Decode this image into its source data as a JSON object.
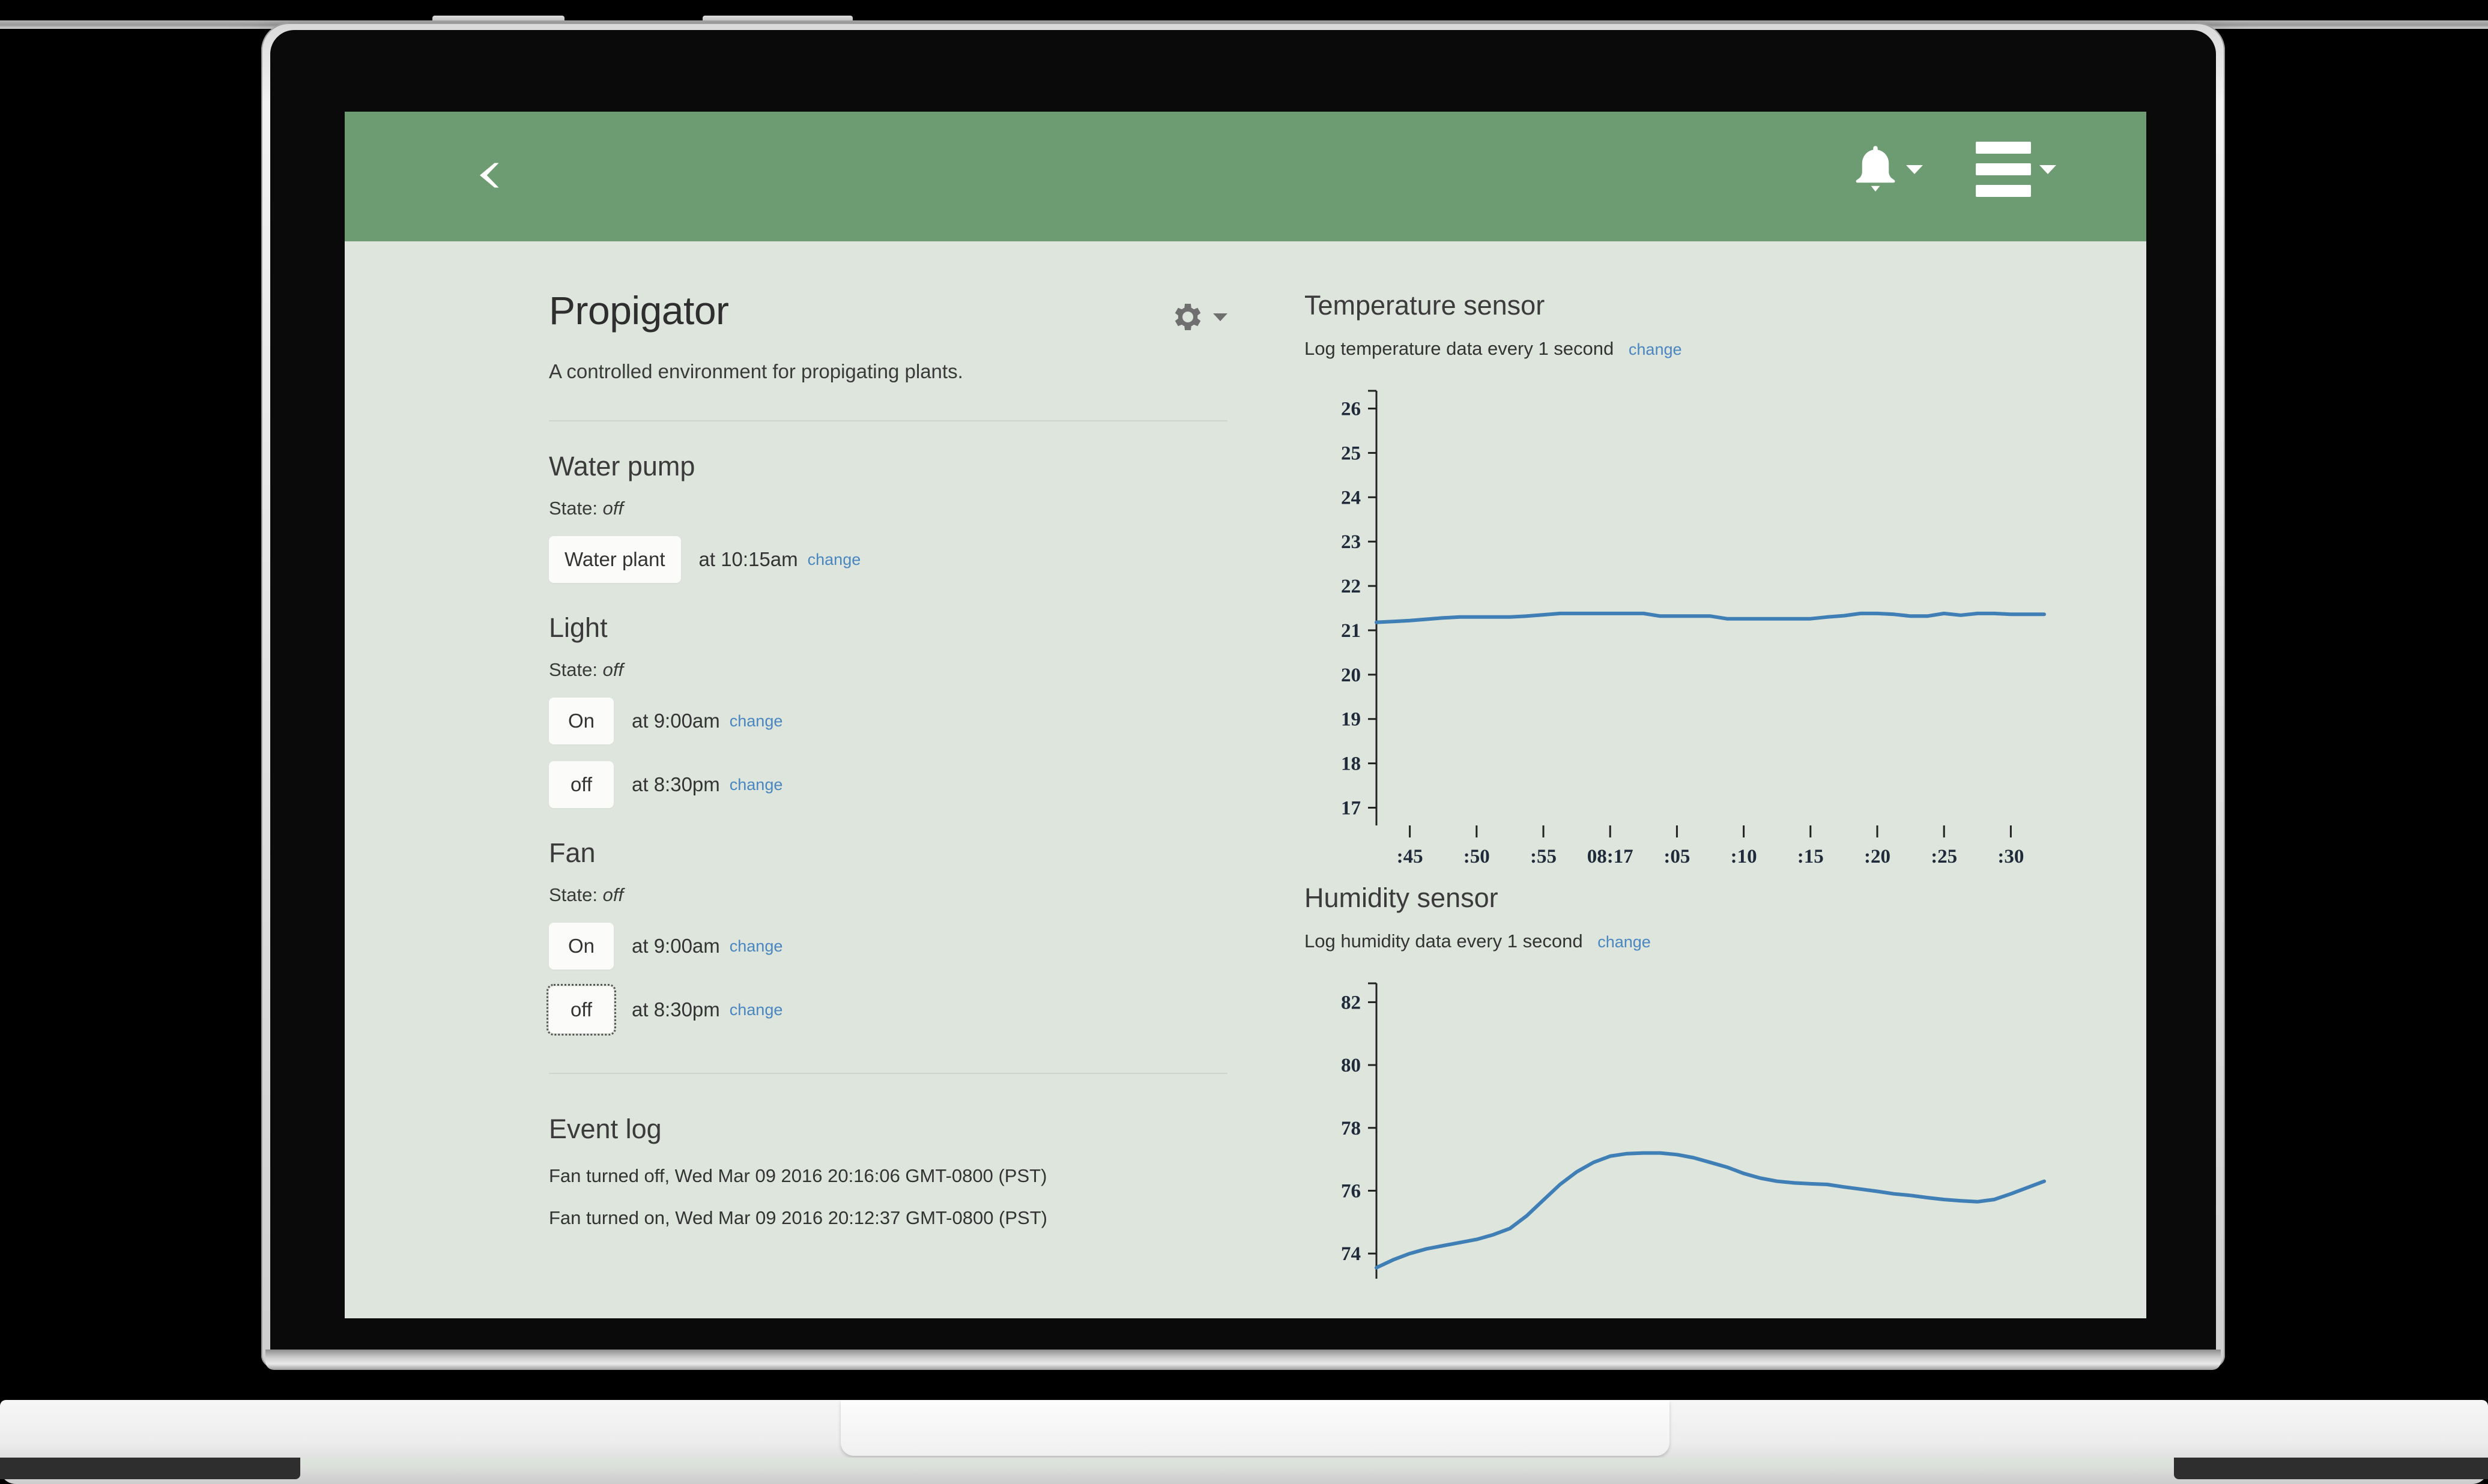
{
  "appbar": {
    "back_icon": "chevron-left-icon",
    "bell_icon": "bell-icon",
    "menu_icon": "hamburger-menu-icon",
    "bell_caret": "caret-down-icon",
    "menu_caret": "caret-down-icon",
    "bg_color": "#6d9c72"
  },
  "page": {
    "title": "Propigator",
    "subtitle": "A controlled environment for propigating plants.",
    "settings_icon": "gear-icon",
    "settings_caret": "caret-down-icon",
    "bg_color": "#dde5dc"
  },
  "devices": [
    {
      "name": "Water pump",
      "state_label": "State:",
      "state_value": "off",
      "schedules": [
        {
          "action": "Water plant",
          "time_text": "at 10:15am",
          "change_label": "change",
          "focused": false
        }
      ]
    },
    {
      "name": "Light",
      "state_label": "State:",
      "state_value": "off",
      "schedules": [
        {
          "action": "On",
          "time_text": "at 9:00am",
          "change_label": "change",
          "focused": false
        },
        {
          "action": "off",
          "time_text": "at 8:30pm",
          "change_label": "change",
          "focused": false
        }
      ]
    },
    {
      "name": "Fan",
      "state_label": "State:",
      "state_value": "off",
      "schedules": [
        {
          "action": "On",
          "time_text": "at 9:00am",
          "change_label": "change",
          "focused": false
        },
        {
          "action": "off",
          "time_text": "at 8:30pm",
          "change_label": "change",
          "focused": true
        }
      ]
    }
  ],
  "event_log": {
    "title": "Event log",
    "entries": [
      "Fan turned off, Wed Mar 09 2016 20:16:06 GMT-0800 (PST)",
      "Fan turned on, Wed Mar 09 2016 20:12:37 GMT-0800 (PST)"
    ]
  },
  "sensors": [
    {
      "title": "Temperature sensor",
      "sub_text": "Log temperature data every 1 second",
      "change_label": "change"
    },
    {
      "title": "Humidity sensor",
      "sub_text": "Log humidity data every 1 second",
      "change_label": "change"
    }
  ],
  "chart_data": [
    {
      "type": "line",
      "title": "Temperature sensor",
      "xlabel": "",
      "ylabel": "",
      "line_color": "#3f7fb5",
      "grid": false,
      "ylim": [
        16.6,
        26.4
      ],
      "yticks": [
        17,
        18,
        19,
        20,
        21,
        22,
        23,
        24,
        25,
        26
      ],
      "xticks": [
        ":45",
        ":50",
        ":55",
        "08:17",
        ":05",
        ":10",
        ":15",
        ":20",
        ":25",
        ":30"
      ],
      "x": [
        0,
        1,
        2,
        3,
        4,
        5,
        6,
        7,
        8,
        9,
        10,
        11,
        12,
        13,
        14,
        15,
        16,
        17,
        18,
        19,
        20,
        21,
        22,
        23,
        24,
        25,
        26,
        27,
        28,
        29,
        30,
        31,
        32,
        33,
        34,
        35,
        36,
        37,
        38,
        39,
        40
      ],
      "values": [
        21.18,
        21.2,
        21.22,
        21.25,
        21.28,
        21.3,
        21.3,
        21.3,
        21.3,
        21.32,
        21.35,
        21.38,
        21.38,
        21.38,
        21.38,
        21.38,
        21.38,
        21.32,
        21.32,
        21.32,
        21.32,
        21.26,
        21.26,
        21.26,
        21.26,
        21.26,
        21.26,
        21.3,
        21.33,
        21.38,
        21.38,
        21.36,
        21.32,
        21.32,
        21.38,
        21.34,
        21.38,
        21.38,
        21.36,
        21.36,
        21.36
      ]
    },
    {
      "type": "line",
      "title": "Humidity sensor",
      "xlabel": "",
      "ylabel": "",
      "line_color": "#3f7fb5",
      "grid": false,
      "ylim": [
        73.2,
        82.6
      ],
      "yticks": [
        74,
        76,
        78,
        80,
        82
      ],
      "xticks": [],
      "x": [
        0,
        1,
        2,
        3,
        4,
        5,
        6,
        7,
        8,
        9,
        10,
        11,
        12,
        13,
        14,
        15,
        16,
        17,
        18,
        19,
        20,
        21,
        22,
        23,
        24,
        25,
        26,
        27,
        28,
        29,
        30,
        31,
        32,
        33,
        34,
        35,
        36,
        37,
        38,
        39,
        40
      ],
      "values": [
        73.55,
        73.8,
        74.0,
        74.15,
        74.25,
        74.35,
        74.45,
        74.6,
        74.8,
        75.2,
        75.7,
        76.2,
        76.6,
        76.9,
        77.1,
        77.18,
        77.2,
        77.2,
        77.15,
        77.05,
        76.9,
        76.75,
        76.55,
        76.4,
        76.3,
        76.25,
        76.22,
        76.2,
        76.12,
        76.05,
        75.98,
        75.9,
        75.85,
        75.78,
        75.72,
        75.68,
        75.65,
        75.72,
        75.9,
        76.1,
        76.3
      ]
    }
  ]
}
